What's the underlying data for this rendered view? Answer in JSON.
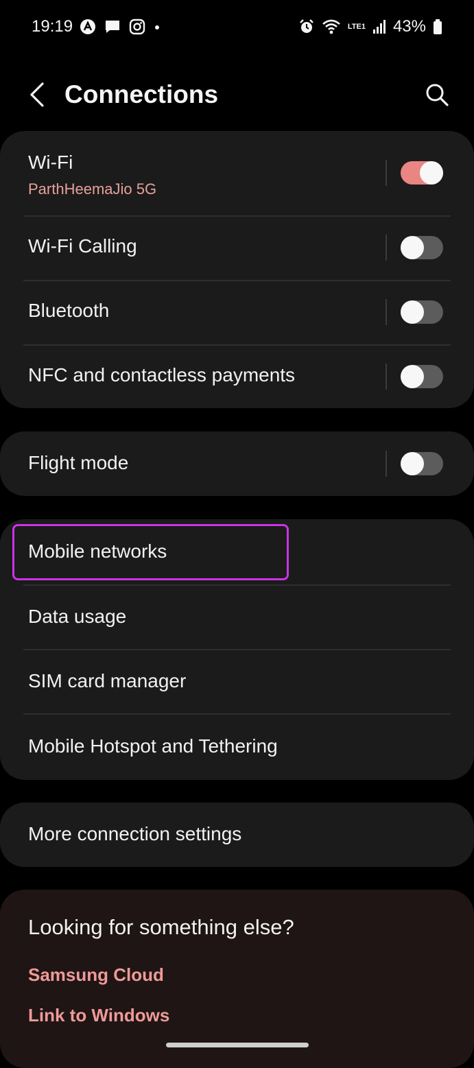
{
  "status_bar": {
    "time": "19:19",
    "battery_percent": "43%",
    "network_label": "LTE1"
  },
  "header": {
    "title": "Connections"
  },
  "group1": {
    "items": [
      {
        "label": "Wi-Fi",
        "subtitle": "ParthHeemaJio 5G",
        "toggle_on": true
      },
      {
        "label": "Wi-Fi Calling",
        "toggle_on": false
      },
      {
        "label": "Bluetooth",
        "toggle_on": false
      },
      {
        "label": "NFC and contactless payments",
        "toggle_on": false
      }
    ]
  },
  "group2": {
    "items": [
      {
        "label": "Flight mode",
        "toggle_on": false
      }
    ]
  },
  "group3": {
    "items": [
      {
        "label": "Mobile networks"
      },
      {
        "label": "Data usage"
      },
      {
        "label": "SIM card manager"
      },
      {
        "label": "Mobile Hotspot and Tethering"
      }
    ]
  },
  "group4": {
    "items": [
      {
        "label": "More connection settings"
      }
    ]
  },
  "suggestions": {
    "title": "Looking for something else?",
    "links": [
      "Samsung Cloud",
      "Link to Windows"
    ]
  },
  "colors": {
    "accent": "#e98583",
    "highlight": "#cc33e6",
    "link": "#ef9a98"
  },
  "icons": {
    "back": "chevron-left-icon",
    "search": "search-icon",
    "alarm": "alarm-icon",
    "wifi": "wifi-icon",
    "signal": "signal-icon",
    "battery": "battery-icon",
    "messages": "message-icon",
    "instagram": "instagram-icon"
  }
}
